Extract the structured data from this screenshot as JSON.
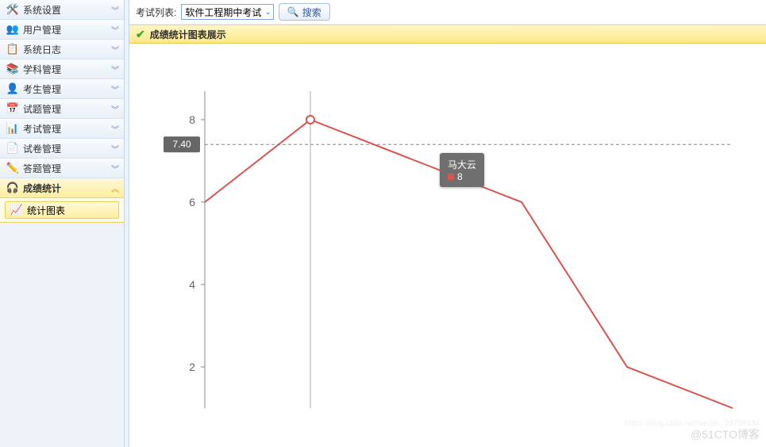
{
  "sidebar": {
    "items": [
      {
        "label": "系统设置",
        "icon": "🛠️"
      },
      {
        "label": "用户管理",
        "icon": "👥"
      },
      {
        "label": "系统日志",
        "icon": "📋"
      },
      {
        "label": "学科管理",
        "icon": "📚"
      },
      {
        "label": "考生管理",
        "icon": "👤"
      },
      {
        "label": "试题管理",
        "icon": "📅"
      },
      {
        "label": "考试管理",
        "icon": "📊"
      },
      {
        "label": "试卷管理",
        "icon": "📄"
      },
      {
        "label": "答题管理",
        "icon": "✏️"
      },
      {
        "label": "成绩统计",
        "icon": "🎧"
      }
    ],
    "active_sub": {
      "label": "统计图表",
      "icon": "📈"
    }
  },
  "topbar": {
    "label": "考试列表:",
    "dropdown_value": "软件工程期中考试",
    "search_label": "搜索"
  },
  "panel": {
    "title": "成绩统计图表展示"
  },
  "tooltip": {
    "name": "马大云",
    "value": "8"
  },
  "watermark": "@51CTO博客",
  "watermark_sub": "https://blog.csdn.net/weixin_39709134",
  "chart_data": {
    "type": "line",
    "x_indices": [
      0,
      1,
      2,
      3,
      4,
      5
    ],
    "values": [
      6,
      8,
      7,
      6,
      2,
      1
    ],
    "y_ticks": [
      2,
      4,
      6,
      8
    ],
    "y_marker": 7.4,
    "ylim": [
      1,
      8.5
    ],
    "highlight_index": 1,
    "tooltip_target_index": 2,
    "series_color": "#d9534f"
  }
}
